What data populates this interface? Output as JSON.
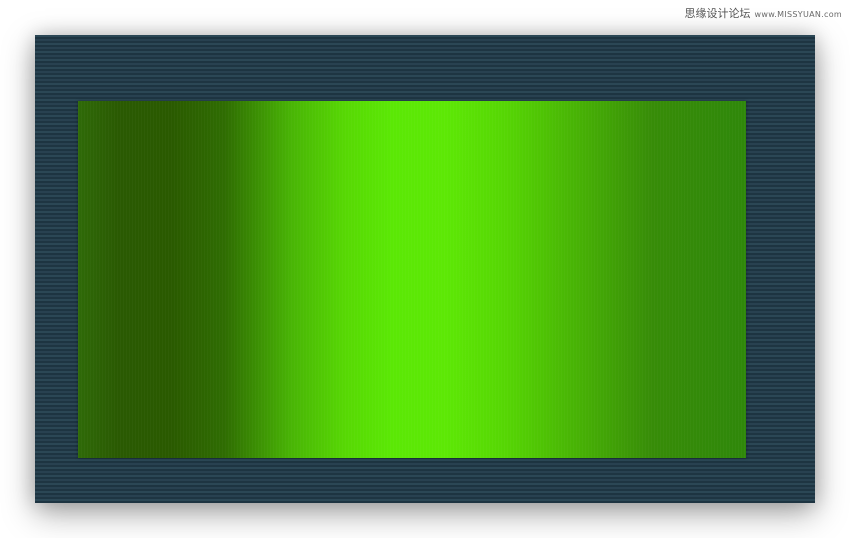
{
  "watermark": {
    "text": "思缘设计论坛",
    "site": "www.MISSYUAN.com"
  },
  "colors": {
    "panel_background": "#223b47",
    "panel_stripe": "#2b4755",
    "gradient_dark_green": "#2a5a00",
    "gradient_bright_green": "#5de805",
    "gradient_mid_green": "#378c08"
  }
}
